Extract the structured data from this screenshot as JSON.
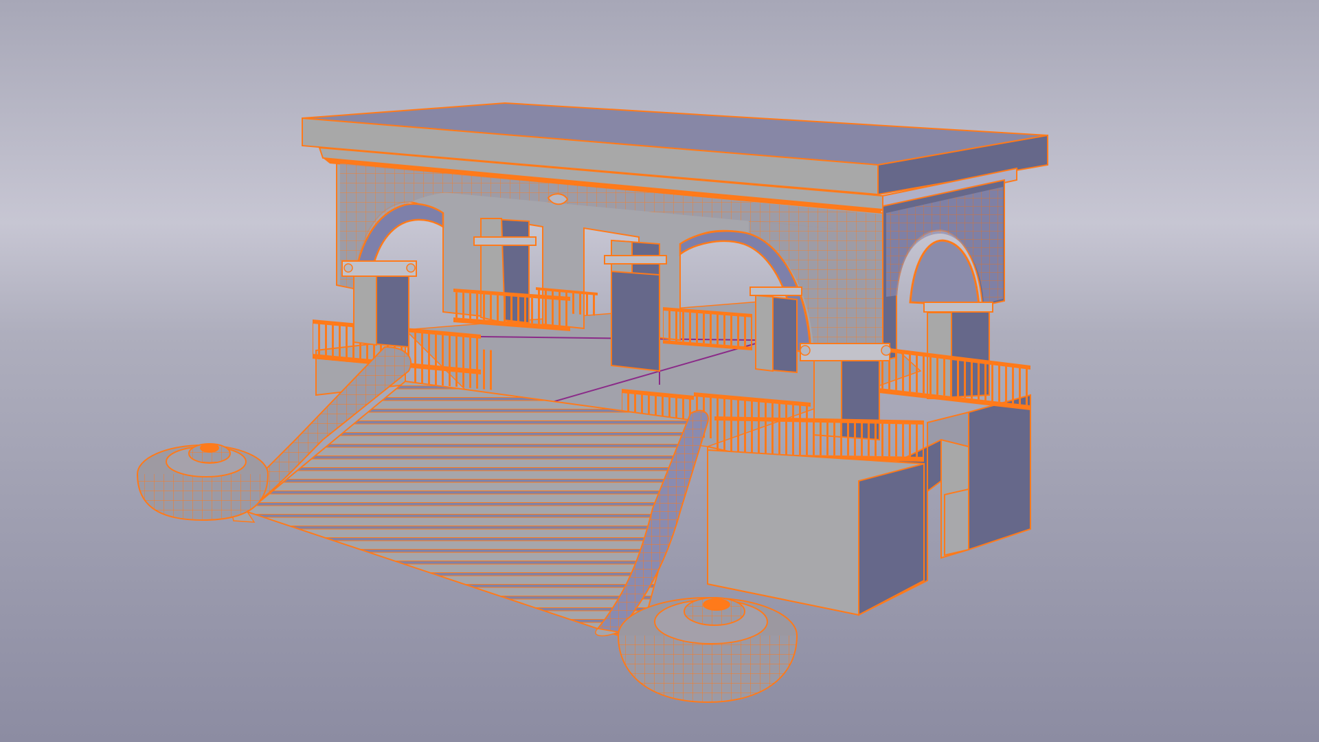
{
  "viewport": {
    "view": "perspective",
    "shading": "solid-with-wireframe",
    "background_gradient": [
      "#a9a9b9",
      "#c6c5d2",
      "#a8a8b6",
      "#8b8ba0"
    ]
  },
  "colors": {
    "wire": "#ff7a1a",
    "wire_dark": "#e8660f",
    "face_light": "#a9a9a9",
    "face_mid": "#8f8f96",
    "face_dark": "#66688a",
    "face_blue": "#7b7fa8",
    "face_top": "#8787a5",
    "axis_x": "#8a2a88",
    "axis_y": "#7a3a9a"
  },
  "scene": {
    "object": "arcade-pavilion",
    "parts": [
      "roof-slab",
      "arcade-frieze",
      "arches",
      "columns",
      "balustrades",
      "staircase",
      "stair-handrails",
      "spiral-scroll-ends",
      "podium"
    ]
  }
}
